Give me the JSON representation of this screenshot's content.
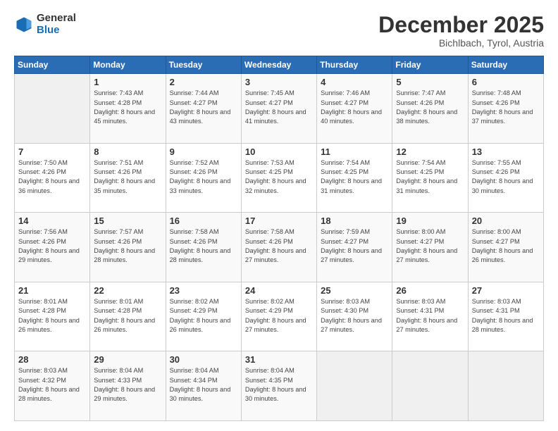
{
  "header": {
    "logo_general": "General",
    "logo_blue": "Blue",
    "month_title": "December 2025",
    "location": "Bichlbach, Tyrol, Austria"
  },
  "days_of_week": [
    "Sunday",
    "Monday",
    "Tuesday",
    "Wednesday",
    "Thursday",
    "Friday",
    "Saturday"
  ],
  "weeks": [
    [
      {
        "num": "",
        "sunrise": "",
        "sunset": "",
        "daylight": ""
      },
      {
        "num": "1",
        "sunrise": "Sunrise: 7:43 AM",
        "sunset": "Sunset: 4:28 PM",
        "daylight": "Daylight: 8 hours and 45 minutes."
      },
      {
        "num": "2",
        "sunrise": "Sunrise: 7:44 AM",
        "sunset": "Sunset: 4:27 PM",
        "daylight": "Daylight: 8 hours and 43 minutes."
      },
      {
        "num": "3",
        "sunrise": "Sunrise: 7:45 AM",
        "sunset": "Sunset: 4:27 PM",
        "daylight": "Daylight: 8 hours and 41 minutes."
      },
      {
        "num": "4",
        "sunrise": "Sunrise: 7:46 AM",
        "sunset": "Sunset: 4:27 PM",
        "daylight": "Daylight: 8 hours and 40 minutes."
      },
      {
        "num": "5",
        "sunrise": "Sunrise: 7:47 AM",
        "sunset": "Sunset: 4:26 PM",
        "daylight": "Daylight: 8 hours and 38 minutes."
      },
      {
        "num": "6",
        "sunrise": "Sunrise: 7:48 AM",
        "sunset": "Sunset: 4:26 PM",
        "daylight": "Daylight: 8 hours and 37 minutes."
      }
    ],
    [
      {
        "num": "7",
        "sunrise": "Sunrise: 7:50 AM",
        "sunset": "Sunset: 4:26 PM",
        "daylight": "Daylight: 8 hours and 36 minutes."
      },
      {
        "num": "8",
        "sunrise": "Sunrise: 7:51 AM",
        "sunset": "Sunset: 4:26 PM",
        "daylight": "Daylight: 8 hours and 35 minutes."
      },
      {
        "num": "9",
        "sunrise": "Sunrise: 7:52 AM",
        "sunset": "Sunset: 4:26 PM",
        "daylight": "Daylight: 8 hours and 33 minutes."
      },
      {
        "num": "10",
        "sunrise": "Sunrise: 7:53 AM",
        "sunset": "Sunset: 4:25 PM",
        "daylight": "Daylight: 8 hours and 32 minutes."
      },
      {
        "num": "11",
        "sunrise": "Sunrise: 7:54 AM",
        "sunset": "Sunset: 4:25 PM",
        "daylight": "Daylight: 8 hours and 31 minutes."
      },
      {
        "num": "12",
        "sunrise": "Sunrise: 7:54 AM",
        "sunset": "Sunset: 4:25 PM",
        "daylight": "Daylight: 8 hours and 31 minutes."
      },
      {
        "num": "13",
        "sunrise": "Sunrise: 7:55 AM",
        "sunset": "Sunset: 4:26 PM",
        "daylight": "Daylight: 8 hours and 30 minutes."
      }
    ],
    [
      {
        "num": "14",
        "sunrise": "Sunrise: 7:56 AM",
        "sunset": "Sunset: 4:26 PM",
        "daylight": "Daylight: 8 hours and 29 minutes."
      },
      {
        "num": "15",
        "sunrise": "Sunrise: 7:57 AM",
        "sunset": "Sunset: 4:26 PM",
        "daylight": "Daylight: 8 hours and 28 minutes."
      },
      {
        "num": "16",
        "sunrise": "Sunrise: 7:58 AM",
        "sunset": "Sunset: 4:26 PM",
        "daylight": "Daylight: 8 hours and 28 minutes."
      },
      {
        "num": "17",
        "sunrise": "Sunrise: 7:58 AM",
        "sunset": "Sunset: 4:26 PM",
        "daylight": "Daylight: 8 hours and 27 minutes."
      },
      {
        "num": "18",
        "sunrise": "Sunrise: 7:59 AM",
        "sunset": "Sunset: 4:27 PM",
        "daylight": "Daylight: 8 hours and 27 minutes."
      },
      {
        "num": "19",
        "sunrise": "Sunrise: 8:00 AM",
        "sunset": "Sunset: 4:27 PM",
        "daylight": "Daylight: 8 hours and 27 minutes."
      },
      {
        "num": "20",
        "sunrise": "Sunrise: 8:00 AM",
        "sunset": "Sunset: 4:27 PM",
        "daylight": "Daylight: 8 hours and 26 minutes."
      }
    ],
    [
      {
        "num": "21",
        "sunrise": "Sunrise: 8:01 AM",
        "sunset": "Sunset: 4:28 PM",
        "daylight": "Daylight: 8 hours and 26 minutes."
      },
      {
        "num": "22",
        "sunrise": "Sunrise: 8:01 AM",
        "sunset": "Sunset: 4:28 PM",
        "daylight": "Daylight: 8 hours and 26 minutes."
      },
      {
        "num": "23",
        "sunrise": "Sunrise: 8:02 AM",
        "sunset": "Sunset: 4:29 PM",
        "daylight": "Daylight: 8 hours and 26 minutes."
      },
      {
        "num": "24",
        "sunrise": "Sunrise: 8:02 AM",
        "sunset": "Sunset: 4:29 PM",
        "daylight": "Daylight: 8 hours and 27 minutes."
      },
      {
        "num": "25",
        "sunrise": "Sunrise: 8:03 AM",
        "sunset": "Sunset: 4:30 PM",
        "daylight": "Daylight: 8 hours and 27 minutes."
      },
      {
        "num": "26",
        "sunrise": "Sunrise: 8:03 AM",
        "sunset": "Sunset: 4:31 PM",
        "daylight": "Daylight: 8 hours and 27 minutes."
      },
      {
        "num": "27",
        "sunrise": "Sunrise: 8:03 AM",
        "sunset": "Sunset: 4:31 PM",
        "daylight": "Daylight: 8 hours and 28 minutes."
      }
    ],
    [
      {
        "num": "28",
        "sunrise": "Sunrise: 8:03 AM",
        "sunset": "Sunset: 4:32 PM",
        "daylight": "Daylight: 8 hours and 28 minutes."
      },
      {
        "num": "29",
        "sunrise": "Sunrise: 8:04 AM",
        "sunset": "Sunset: 4:33 PM",
        "daylight": "Daylight: 8 hours and 29 minutes."
      },
      {
        "num": "30",
        "sunrise": "Sunrise: 8:04 AM",
        "sunset": "Sunset: 4:34 PM",
        "daylight": "Daylight: 8 hours and 30 minutes."
      },
      {
        "num": "31",
        "sunrise": "Sunrise: 8:04 AM",
        "sunset": "Sunset: 4:35 PM",
        "daylight": "Daylight: 8 hours and 30 minutes."
      },
      {
        "num": "",
        "sunrise": "",
        "sunset": "",
        "daylight": ""
      },
      {
        "num": "",
        "sunrise": "",
        "sunset": "",
        "daylight": ""
      },
      {
        "num": "",
        "sunrise": "",
        "sunset": "",
        "daylight": ""
      }
    ]
  ]
}
